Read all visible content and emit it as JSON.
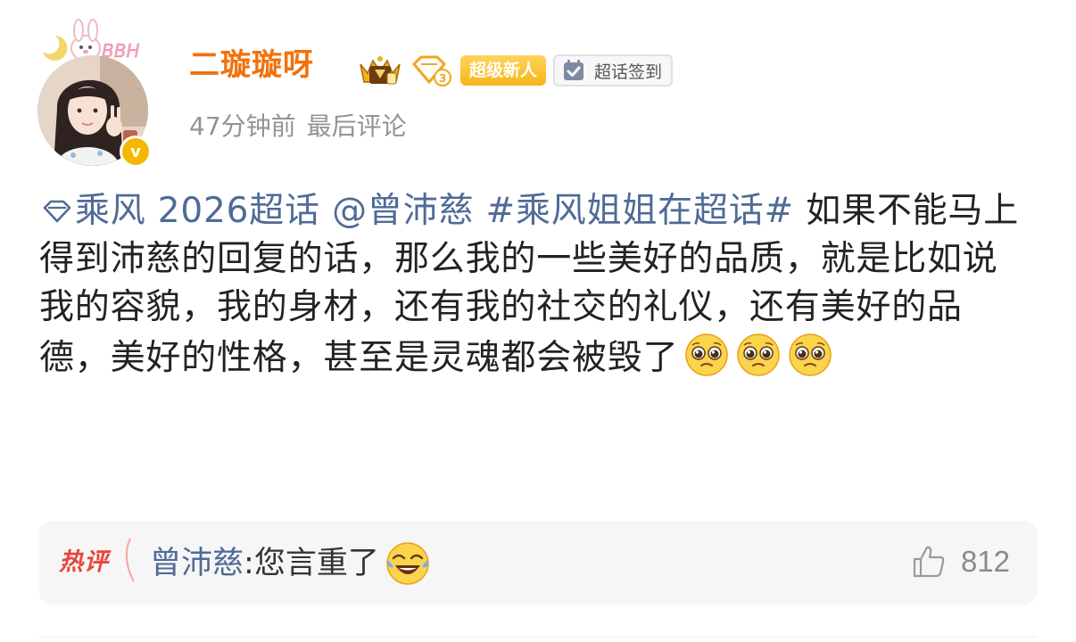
{
  "header": {
    "avatar_deco_text": "BBH",
    "verified_mark": "v",
    "username": "二璇璇呀",
    "badges": {
      "crown_icon": "crown-medal-icon",
      "level_icon": "diamond-level-3-icon",
      "super_new_label": "超级新人",
      "checkin_icon": "calendar-check-icon",
      "checkin_label": "超话签到"
    },
    "meta": {
      "time": "47分钟前",
      "action": "最后评论"
    }
  },
  "post": {
    "topic_icon": "diamond-outline-icon",
    "topic": "乘风 2026超话",
    "mention": "@曾沛慈",
    "hashtag": "#乘风姐姐在超话#",
    "text": "如果不能马上得到沛慈的回复的话，那么我的一些美好的品质，就是比如说我的容貌，我的身材，还有我的社交的礼仪，还有美好的品德，美好的性格，甚至是灵魂都会被毁了",
    "trailing_emoji": [
      "pleading-face",
      "pleading-face",
      "pleading-face"
    ]
  },
  "hot_comment": {
    "tag": "热评",
    "user": "曾沛慈",
    "separator": ": ",
    "text": "您言重了",
    "emoji": "laughing-tears-face",
    "like_icon": "thumbs-up-icon",
    "like_count": "812"
  },
  "colors": {
    "username": "#f2710c",
    "link": "#4f6b97",
    "hot_tag": "#e8453c",
    "meta": "#939393",
    "badge_gold": "#f7b417"
  }
}
